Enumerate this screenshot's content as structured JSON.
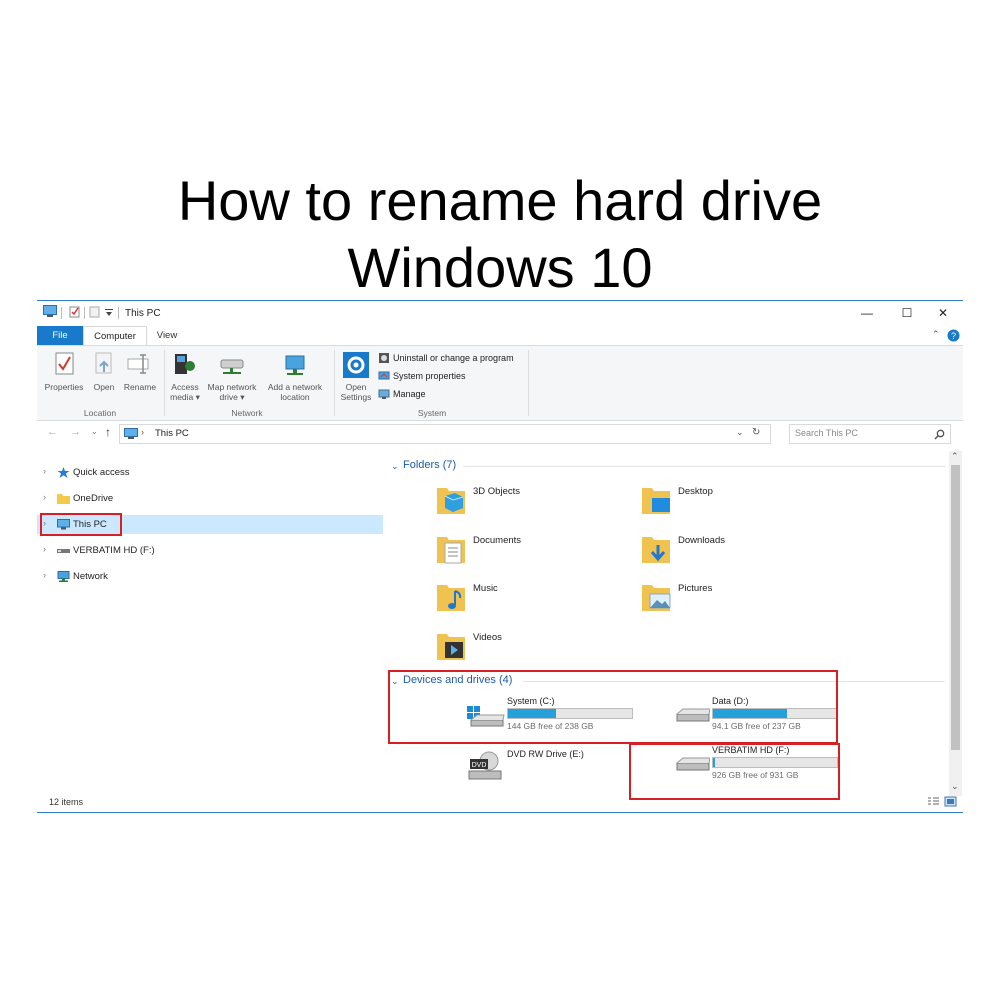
{
  "heading": {
    "line1": "How to rename hard drive",
    "line2": "Windows 10"
  },
  "window": {
    "title": "This PC",
    "controls": {
      "minimize": "—",
      "maximize": "☐",
      "close": "✕"
    },
    "tabs": {
      "file": "File",
      "computer": "Computer",
      "view": "View"
    },
    "ribbon": {
      "location": {
        "label": "Location",
        "properties": "Properties",
        "open": "Open",
        "rename": "Rename"
      },
      "network": {
        "label": "Network",
        "access_media_1": "Access",
        "access_media_2": "media ▾",
        "map_drive_1": "Map network",
        "map_drive_2": "drive ▾",
        "add_location_1": "Add a network",
        "add_location_2": "location"
      },
      "system": {
        "label": "System",
        "open_settings_1": "Open",
        "open_settings_2": "Settings",
        "uninstall": "Uninstall or change a program",
        "system_properties": "System properties",
        "manage": "Manage"
      }
    },
    "address": {
      "path": "This PC",
      "search_placeholder": "Search This PC"
    },
    "nav": [
      {
        "label": "Quick access"
      },
      {
        "label": "OneDrive"
      },
      {
        "label": "This PC"
      },
      {
        "label": "VERBATIM HD (F:)"
      },
      {
        "label": "Network"
      }
    ],
    "folders_header": "Folders (7)",
    "folders": [
      {
        "label": "3D Objects"
      },
      {
        "label": "Desktop"
      },
      {
        "label": "Documents"
      },
      {
        "label": "Downloads"
      },
      {
        "label": "Music"
      },
      {
        "label": "Pictures"
      },
      {
        "label": "Videos"
      }
    ],
    "drives_header": "Devices and drives (4)",
    "drives": [
      {
        "name": "System (C:)",
        "free": "144 GB free of 238 GB",
        "used_fraction": 0.39
      },
      {
        "name": "Data (D:)",
        "free": "94.1 GB free of 237 GB",
        "used_fraction": 0.6
      },
      {
        "name": "DVD RW Drive (E:)"
      },
      {
        "name": "VERBATIM HD (F:)",
        "free": "926 GB free of 931 GB",
        "used_fraction": 0.02
      }
    ],
    "status": {
      "items": "12 items"
    }
  },
  "colors": {
    "accent": "#1979ca",
    "highlight_box": "#d91f26",
    "selection": "#cce8ff",
    "drive_fill": "#26a0da"
  }
}
